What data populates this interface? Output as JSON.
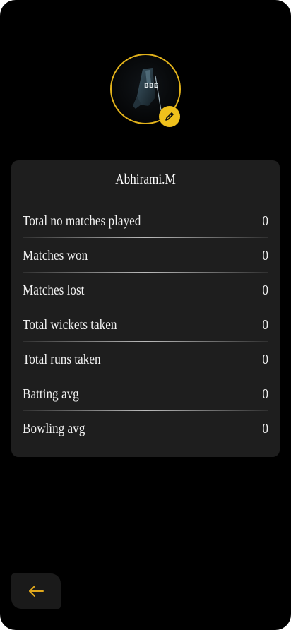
{
  "profile": {
    "name": "Abhirami.M",
    "avatar_icon": "cricket-bat-icon",
    "edit_icon": "pencil-icon"
  },
  "stats": [
    {
      "label": "Total no matches played",
      "value": "0"
    },
    {
      "label": "Matches won",
      "value": "0"
    },
    {
      "label": "Matches lost",
      "value": "0"
    },
    {
      "label": "Total wickets taken",
      "value": "0"
    },
    {
      "label": "Total runs taken",
      "value": "0"
    },
    {
      "label": "Batting avg",
      "value": "0"
    },
    {
      "label": "Bowling avg",
      "value": "0"
    }
  ],
  "nav": {
    "back_icon": "arrow-left-icon"
  },
  "colors": {
    "accent": "#f0c11c",
    "background": "#000000",
    "card": "#1e1e1e"
  }
}
